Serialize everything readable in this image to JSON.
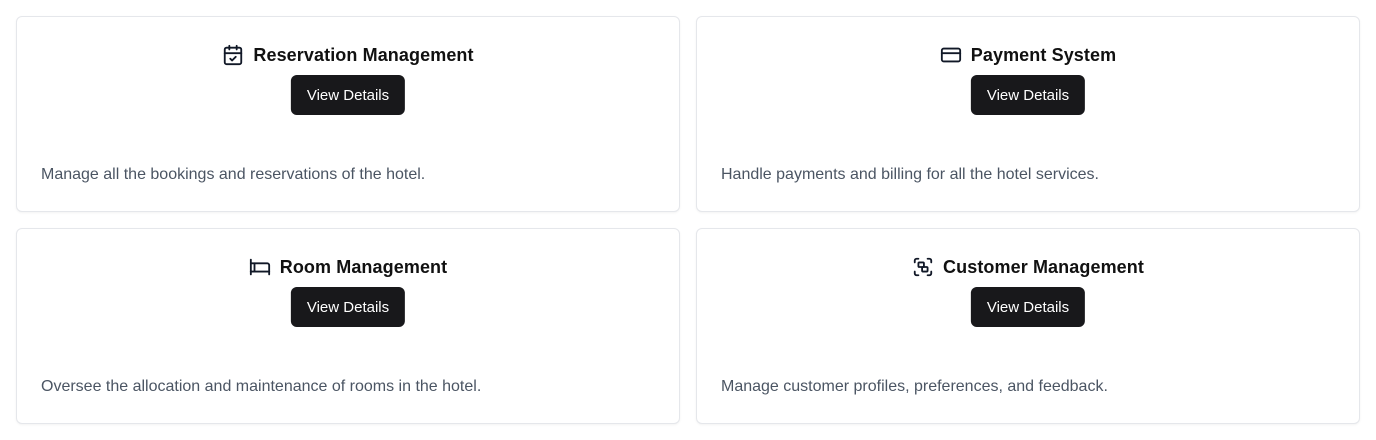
{
  "cards": [
    {
      "title": "Reservation Management",
      "icon": "calendar-check-icon",
      "button_label": "View Details",
      "description": "Manage all the bookings and reservations of the hotel."
    },
    {
      "title": "Payment System",
      "icon": "credit-card-icon",
      "button_label": "View Details",
      "description": "Handle payments and billing for all the hotel services."
    },
    {
      "title": "Room Management",
      "icon": "bed-icon",
      "button_label": "View Details",
      "description": "Oversee the allocation and maintenance of rooms in the hotel."
    },
    {
      "title": "Customer Management",
      "icon": "scan-face-icon",
      "button_label": "View Details",
      "description": "Manage customer profiles, preferences, and feedback."
    }
  ],
  "colors": {
    "button_bg": "#18181b",
    "button_text": "#ffffff",
    "title_text": "#111111",
    "description_text": "#4b5563",
    "card_border": "#e5e7eb"
  }
}
